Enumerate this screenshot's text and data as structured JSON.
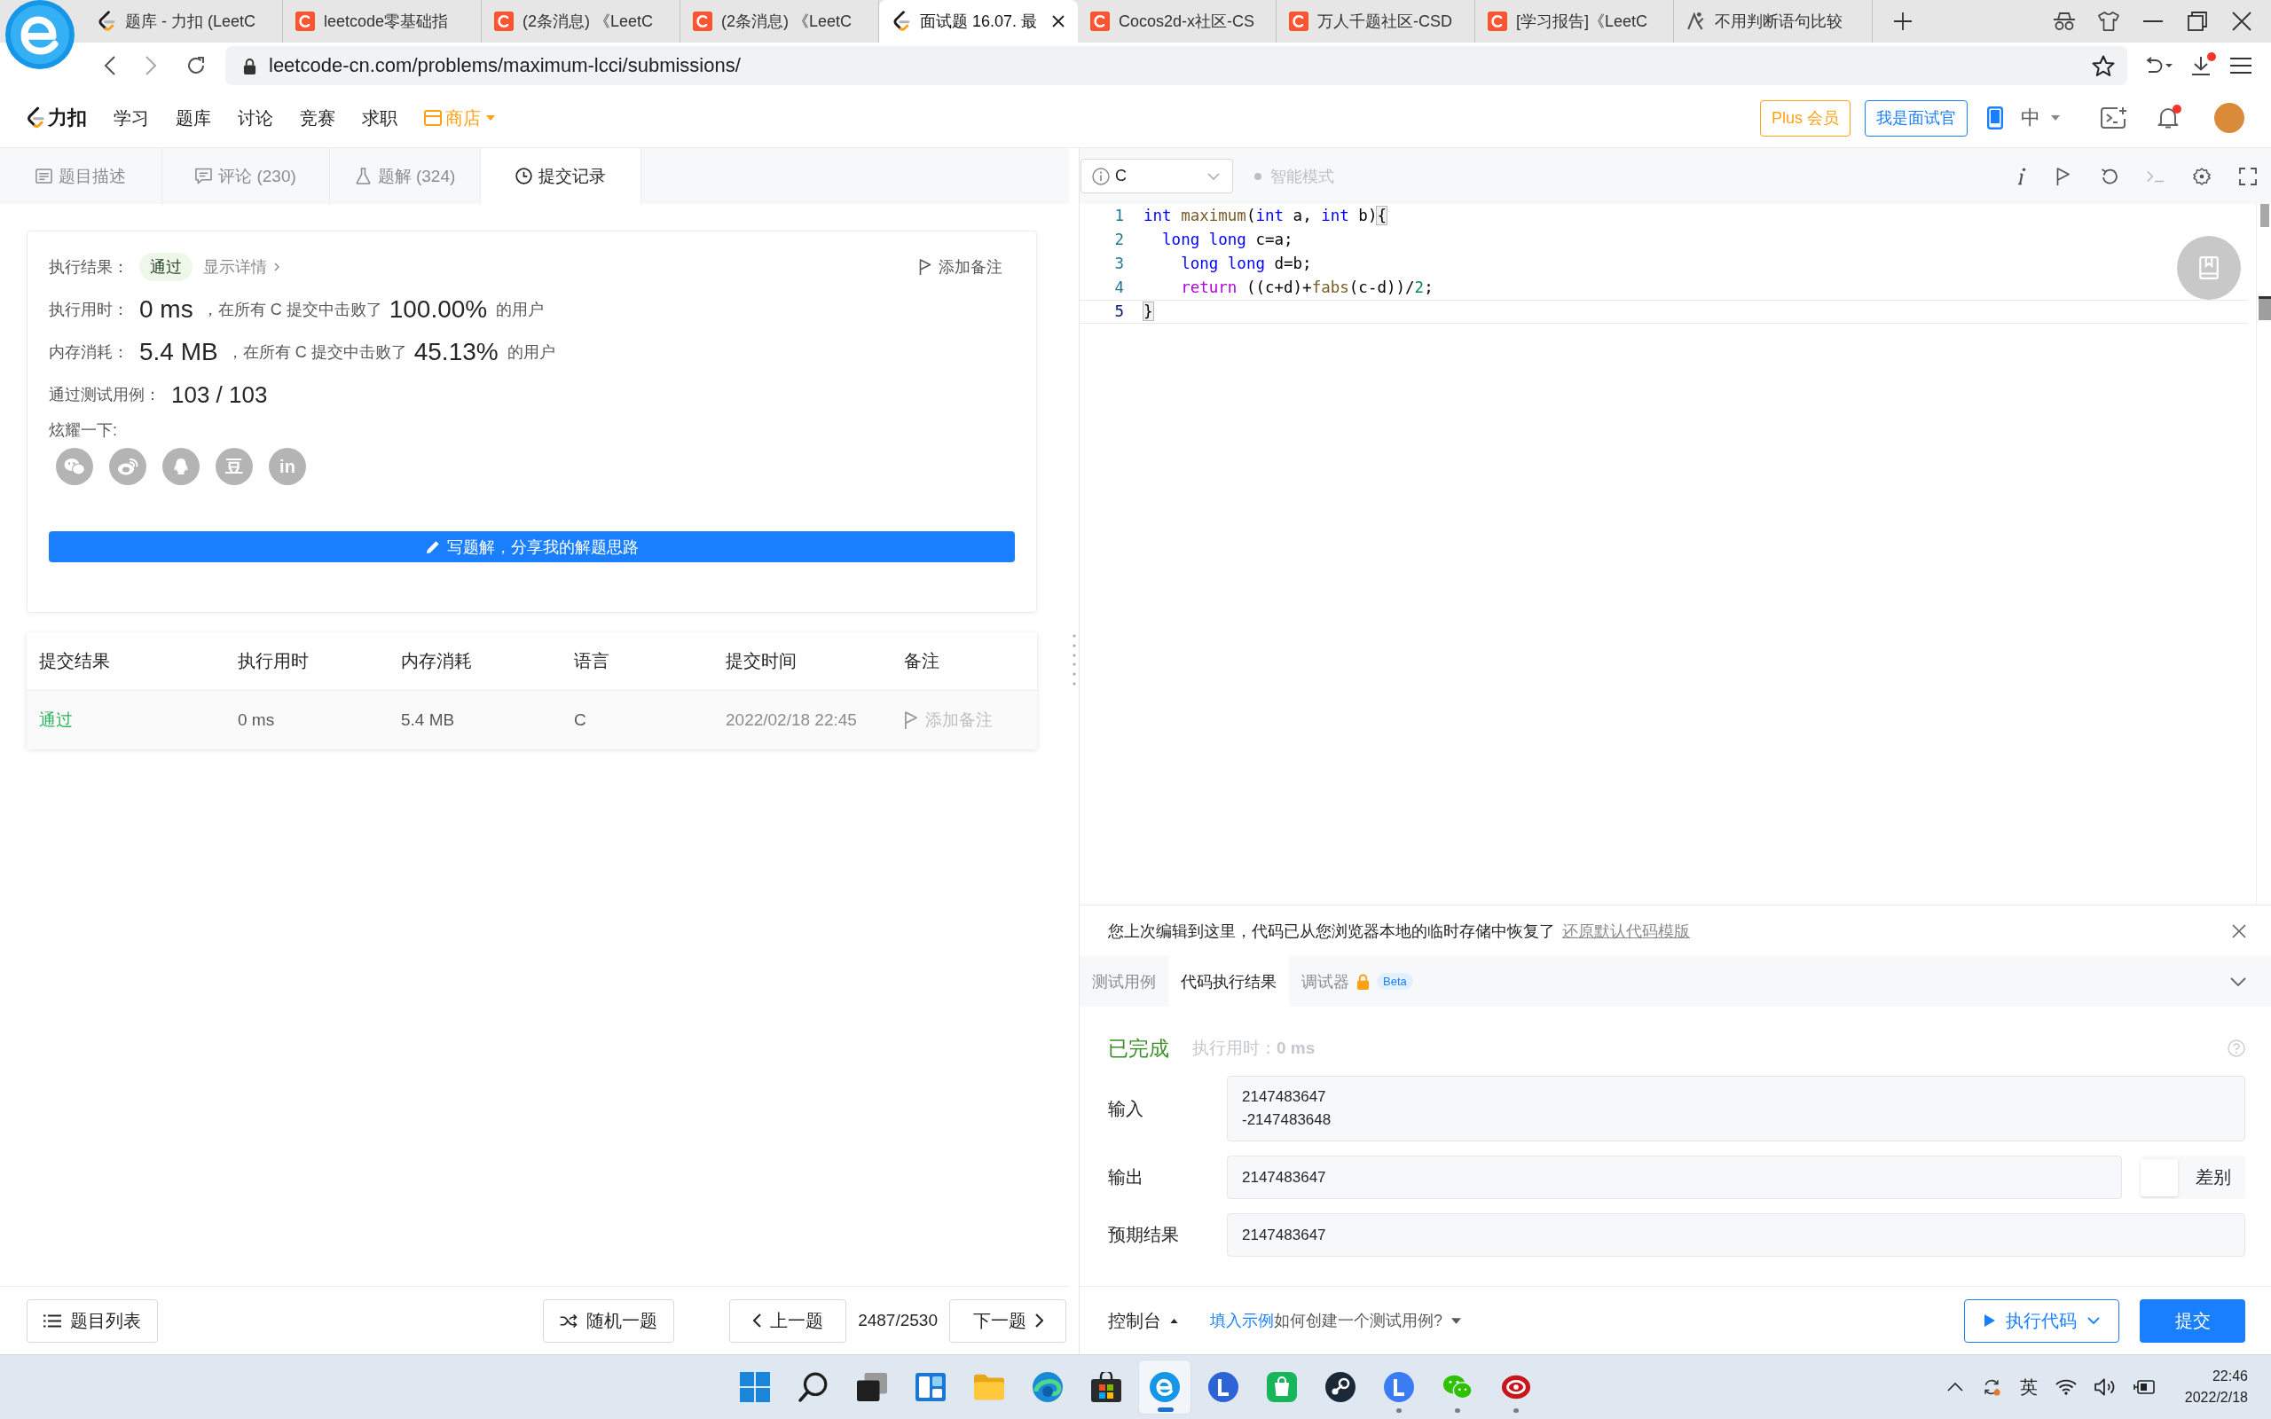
{
  "browser": {
    "tabs": [
      {
        "kind": "leetcode",
        "title": "题库 - 力扣 (LeetC",
        "selected": false
      },
      {
        "kind": "csdn",
        "title": "leetcode零基础指",
        "selected": false
      },
      {
        "kind": "csdn",
        "title": "(2条消息) 《LeetC",
        "selected": false
      },
      {
        "kind": "csdn",
        "title": "(2条消息) 《LeetC",
        "selected": false
      },
      {
        "kind": "leetcode",
        "title": "面试题 16.07. 最",
        "selected": true
      },
      {
        "kind": "csdn",
        "title": "Cocos2d-x社区-CS",
        "selected": false
      },
      {
        "kind": "csdn",
        "title": "万人千题社区-CSD",
        "selected": false
      },
      {
        "kind": "csdn",
        "title": "[学习报告]《LeetC",
        "selected": false
      },
      {
        "kind": "other",
        "title": "不用判断语句比较",
        "selected": false
      }
    ],
    "url": "leetcode-cn.com/problems/maximum-lcci/submissions/",
    "downloads_unread": true
  },
  "site_nav": {
    "brand": "力扣",
    "links": [
      "学习",
      "题库",
      "讨论",
      "竞赛",
      "求职"
    ],
    "shop": "商店",
    "plus_button": "Plus 会员",
    "interviewer_button": "我是面试官",
    "language": "中",
    "notifications_unread": true
  },
  "problem_tabs": [
    {
      "kind": "description",
      "label": "题目描述",
      "selected": false
    },
    {
      "kind": "comments",
      "label": "评论 (230)",
      "selected": false
    },
    {
      "kind": "solutions",
      "label": "题解 (324)",
      "selected": false
    },
    {
      "kind": "submissions",
      "label": "提交记录",
      "selected": true
    }
  ],
  "result": {
    "status_label": "执行结果：",
    "status": "通过",
    "details_link": "显示详情",
    "add_note": "添加备注",
    "runtime": {
      "label": "执行用时：",
      "value": "0 ms",
      "beats_text": "，在所有 C 提交中击败了",
      "percent": "100.00%",
      "suffix": "的用户"
    },
    "memory": {
      "label": "内存消耗：",
      "value": "5.4 MB",
      "beats_text": "，在所有 C 提交中击败了",
      "percent": "45.13%",
      "suffix": "的用户"
    },
    "testcases": {
      "label": "通过测试用例：",
      "value": "103 / 103"
    },
    "share_label": "炫耀一下:",
    "share_buttons": [
      {
        "kind": "wechat"
      },
      {
        "kind": "weibo"
      },
      {
        "kind": "qq"
      },
      {
        "kind": "douban",
        "glyph": "豆"
      },
      {
        "kind": "linkedin",
        "glyph": "in"
      }
    ],
    "write_solution_button": "写题解，分享我的解题思路"
  },
  "submissions": {
    "columns": [
      "提交结果",
      "执行用时",
      "内存消耗",
      "语言",
      "提交时间",
      "备注"
    ],
    "rows": [
      {
        "status": "通过",
        "runtime": "0 ms",
        "memory": "5.4 MB",
        "language": "C",
        "time": "2022/02/18 22:45",
        "note": "添加备注"
      }
    ]
  },
  "editor": {
    "language": "C",
    "smart_mode": {
      "label": "智能模式",
      "on": false
    },
    "lines": [
      {
        "number": "1",
        "current": false,
        "tokens": [
          {
            "kind": "keyword",
            "text": "int"
          },
          {
            "kind": "function",
            "text": " maximum"
          },
          {
            "kind": "plain",
            "text": "("
          },
          {
            "kind": "keyword",
            "text": "int"
          },
          {
            "kind": "plain",
            "text": " a, "
          },
          {
            "kind": "keyword",
            "text": "int"
          },
          {
            "kind": "plain",
            "text": " b)"
          },
          {
            "kind": "bracket",
            "text": "{"
          }
        ]
      },
      {
        "number": "2",
        "current": false,
        "tokens": [
          {
            "kind": "keyword",
            "text": "  long long"
          },
          {
            "kind": "plain",
            "text": " c=a;"
          }
        ]
      },
      {
        "number": "3",
        "current": false,
        "tokens": [
          {
            "kind": "keyword",
            "text": "    long long"
          },
          {
            "kind": "plain",
            "text": " d=b;"
          }
        ]
      },
      {
        "number": "4",
        "current": false,
        "tokens": [
          {
            "kind": "control",
            "text": "    return"
          },
          {
            "kind": "plain",
            "text": " ((c+d)+"
          },
          {
            "kind": "function",
            "text": "fabs"
          },
          {
            "kind": "plain",
            "text": "(c-d))/"
          },
          {
            "kind": "number",
            "text": "2"
          },
          {
            "kind": "plain",
            "text": ";"
          }
        ]
      },
      {
        "number": "5",
        "current": true,
        "tokens": [
          {
            "kind": "bracket",
            "text": "}"
          }
        ]
      }
    ]
  },
  "notice": {
    "text": "您上次编辑到这里，代码已从您浏览器本地的临时存储中恢复了",
    "link": "还原默认代码模版"
  },
  "console": {
    "tabs": [
      {
        "label": "测试用例",
        "selected": false,
        "locked": false
      },
      {
        "label": "代码执行结果",
        "selected": true,
        "locked": false
      },
      {
        "label": "调试器",
        "selected": false,
        "locked": true,
        "badge": "Beta"
      }
    ],
    "status": "已完成",
    "runtime_label": "执行用时：",
    "runtime_value": "0 ms",
    "fields": [
      {
        "label": "输入",
        "lines": [
          "2147483647",
          "-2147483648"
        ]
      },
      {
        "label": "输出",
        "lines": [
          "2147483647"
        ],
        "diff": {
          "label": "差别",
          "on": false
        }
      },
      {
        "label": "预期结果",
        "lines": [
          "2147483647"
        ]
      }
    ]
  },
  "left_footer": {
    "list_button": "题目列表",
    "random_button": "随机一题",
    "prev_button": "上一题",
    "position": "2487/2530",
    "next_button": "下一题"
  },
  "right_footer": {
    "console_button": "控制台",
    "fill_example_link": "填入示例",
    "help_link": "如何创建一个测试用例?",
    "run_button": "执行代码",
    "submit_button": "提交"
  },
  "taskbar": {
    "apps": [
      {
        "kind": "start",
        "running": false,
        "selected": false
      },
      {
        "kind": "search",
        "running": false,
        "selected": false
      },
      {
        "kind": "task-view",
        "running": false,
        "selected": false
      },
      {
        "kind": "widgets",
        "running": false,
        "selected": false
      },
      {
        "kind": "folder",
        "running": false,
        "selected": false
      },
      {
        "kind": "swirl",
        "running": false,
        "selected": false
      },
      {
        "kind": "store",
        "running": false,
        "selected": false
      },
      {
        "kind": "browser",
        "running": true,
        "selected": true
      },
      {
        "kind": "l-dark",
        "running": false,
        "selected": false
      },
      {
        "kind": "shopping",
        "running": false,
        "selected": false
      },
      {
        "kind": "steam",
        "running": false,
        "selected": false
      },
      {
        "kind": "l-blue",
        "running": true,
        "selected": false
      },
      {
        "kind": "chat",
        "running": true,
        "selected": false
      },
      {
        "kind": "red-swirl",
        "running": true,
        "selected": false
      }
    ],
    "ime": "英",
    "time": "22:46",
    "date": "2022/2/18"
  }
}
